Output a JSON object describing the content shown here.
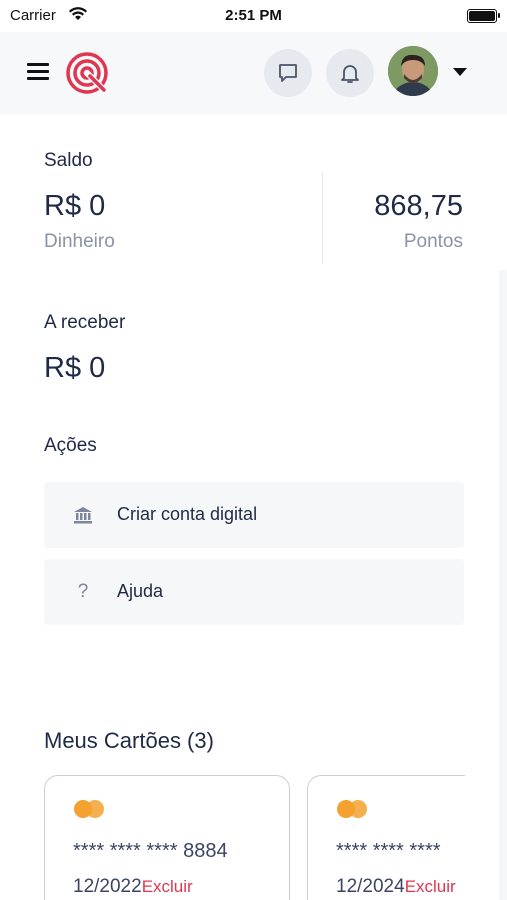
{
  "status_bar": {
    "carrier": "Carrier",
    "time": "2:51 PM"
  },
  "header": {
    "icons": [
      "menu-icon",
      "app-logo",
      "chat-icon",
      "bell-icon",
      "avatar",
      "caret-down-icon"
    ]
  },
  "balance": {
    "title": "Saldo",
    "money_value": "R$ 0",
    "money_caption": "Dinheiro",
    "points_value": "868,75",
    "points_caption": "Pontos"
  },
  "receivable": {
    "title": "A receber",
    "value": "R$ 0"
  },
  "actions": {
    "title": "Ações",
    "items": [
      {
        "label": "Criar conta digital",
        "icon": "bank-icon"
      },
      {
        "label": "Ajuda",
        "icon": "question-icon"
      }
    ]
  },
  "cards": {
    "title": "Meus Cartões (3)",
    "items": [
      {
        "masked": "**** **** ****",
        "last4": "8884",
        "expiry": "12/2022",
        "delete_label": "Excluir"
      },
      {
        "masked": "**** **** ****",
        "last4": "",
        "expiry": "12/2024",
        "delete_label": "Excluir"
      }
    ]
  },
  "colors": {
    "accent_red": "#e0364f",
    "text_dark": "#1f2a44",
    "muted": "#8a93a6",
    "mastercard": "#f4a12f"
  }
}
